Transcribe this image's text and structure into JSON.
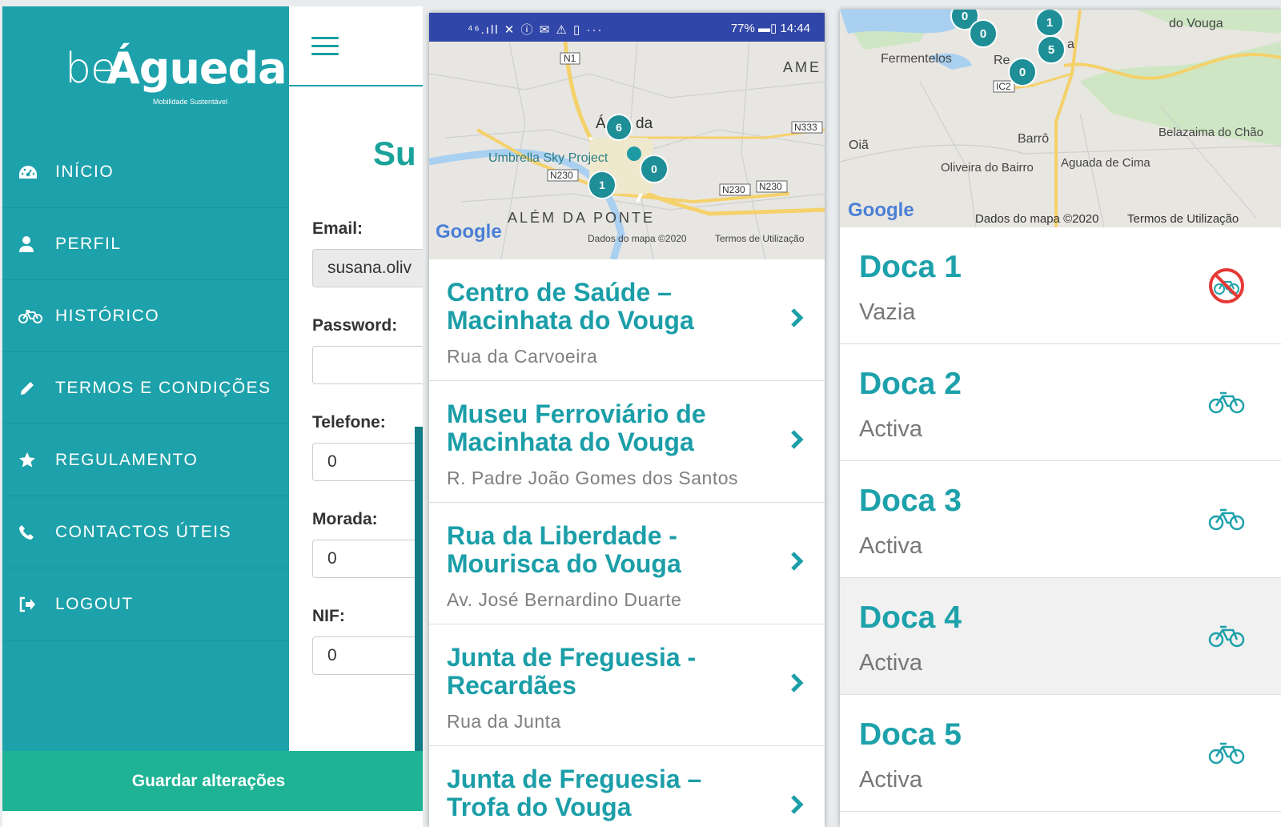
{
  "app": {
    "logo_prefix": "be",
    "logo_main": "Águeda",
    "logo_tagline": "Mobilidade Sustentável"
  },
  "menu": [
    {
      "label": "INÍCIO",
      "icon": "dashboard-icon"
    },
    {
      "label": "PERFIL",
      "icon": "user-icon"
    },
    {
      "label": "HISTÓRICO",
      "icon": "bicycle-icon"
    },
    {
      "label": "TERMOS E CONDIÇÕES",
      "icon": "pencil-icon"
    },
    {
      "label": "REGULAMENTO",
      "icon": "star-icon"
    },
    {
      "label": "CONTACTOS ÚTEIS",
      "icon": "phone-icon"
    },
    {
      "label": "LOGOUT",
      "icon": "logout-icon"
    }
  ],
  "profile": {
    "title_partial": "Su",
    "email_label": "Email:",
    "email_value": "susana.oliv",
    "password_label": "Password:",
    "password_value": "",
    "phone_label": "Telefone:",
    "phone_value": "0",
    "address_label": "Morada:",
    "address_value": "0",
    "nif_label": "NIF:",
    "nif_value": "0",
    "save_label": "Guardar alterações"
  },
  "phone": {
    "status_left": "⁴⁶.ıll ✕ ⓘ ✉ ⚠ ▯ ···",
    "status_right": "77% ▬▯ 14:44"
  },
  "map2": {
    "labels": [
      "AME",
      "Á",
      "da",
      "Umbrella Sky Project",
      "ALÉM DA PONTE"
    ],
    "road_shields": [
      "N1",
      "N333",
      "N230",
      "N230",
      "N230"
    ],
    "clusters": [
      "6",
      "0",
      "1"
    ],
    "google": "Google",
    "attribution": "Dados do mapa ©2020",
    "terms": "Termos de Utilização"
  },
  "locations": [
    {
      "name": "Centro de Saúde – Macinhata do Vouga",
      "address": "Rua da Carvoeira"
    },
    {
      "name": "Museu Ferroviário de Macinhata do Vouga",
      "address": "R. Padre João Gomes dos Santos"
    },
    {
      "name": "Rua da Liberdade - Mourisca do Vouga",
      "address": "Av. José Bernardino Duarte"
    },
    {
      "name": "Junta de Freguesia - Recardães",
      "address": "Rua da Junta"
    },
    {
      "name": "Junta de Freguesia – Trofa do Vouga",
      "address": ""
    }
  ],
  "map3": {
    "labels": [
      "do Vouga",
      "Fermentelos",
      "Re",
      "a",
      "Oiã",
      "Barrô",
      "Belazaima do Chão",
      "Oliveira do Bairro",
      "Aguada de Cima"
    ],
    "road_shields": [
      "IC2"
    ],
    "clusters": [
      "0",
      "0",
      "1",
      "5",
      "0"
    ],
    "google": "Google",
    "attribution": "Dados do mapa ©2020",
    "terms": "Termos de Utilização"
  },
  "docks": [
    {
      "name": "Doca 1",
      "status": "Vazia",
      "icon": "no-bike-icon"
    },
    {
      "name": "Doca 2",
      "status": "Activa",
      "icon": "bicycle-icon"
    },
    {
      "name": "Doca 3",
      "status": "Activa",
      "icon": "bicycle-icon"
    },
    {
      "name": "Doca 4",
      "status": "Activa",
      "icon": "bicycle-icon"
    },
    {
      "name": "Doca 5",
      "status": "Activa",
      "icon": "bicycle-icon"
    }
  ],
  "colors": {
    "teal": "#1da1ab",
    "green_button": "#1db394",
    "status_bar": "#3046a8",
    "empty_red": "#e53935"
  }
}
